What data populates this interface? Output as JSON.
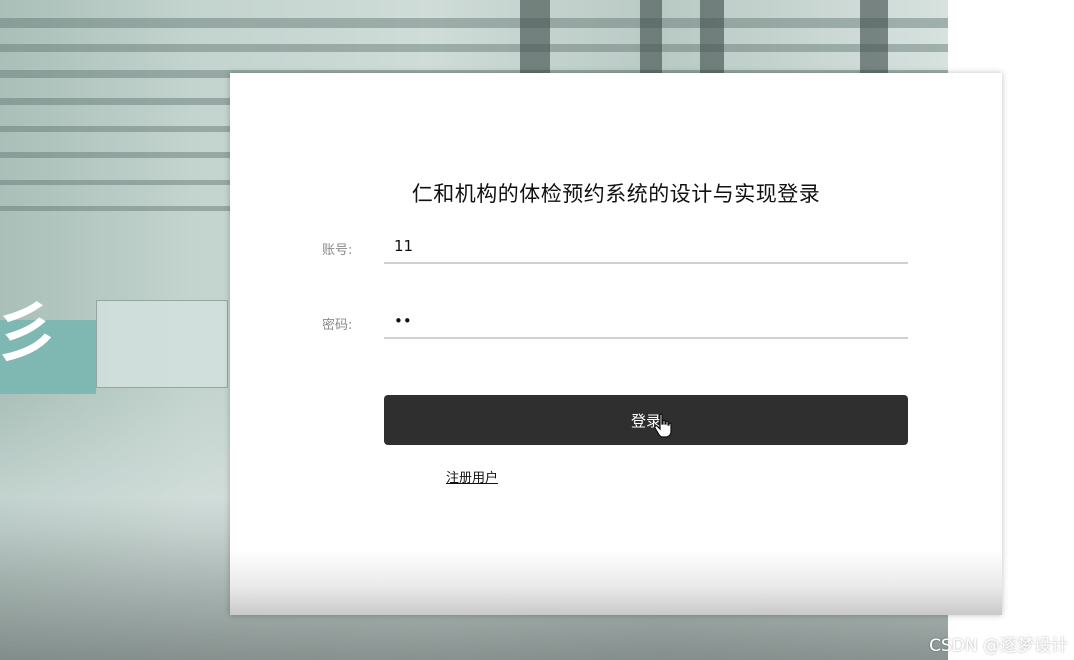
{
  "login": {
    "title": "仁和机构的体检预约系统的设计与实现登录",
    "account_label": "账号:",
    "account_value": "11",
    "password_label": "密码:",
    "password_value": "11",
    "login_button": "登录",
    "register_link": "注册用户"
  },
  "watermark": "CSDN @逐梦设计",
  "colors": {
    "button_bg": "#2f2f2f",
    "card_bg": "#ffffff",
    "accent_teal": "#7fb8b2"
  },
  "icons": {
    "cursor": "hand-pointer-icon"
  }
}
